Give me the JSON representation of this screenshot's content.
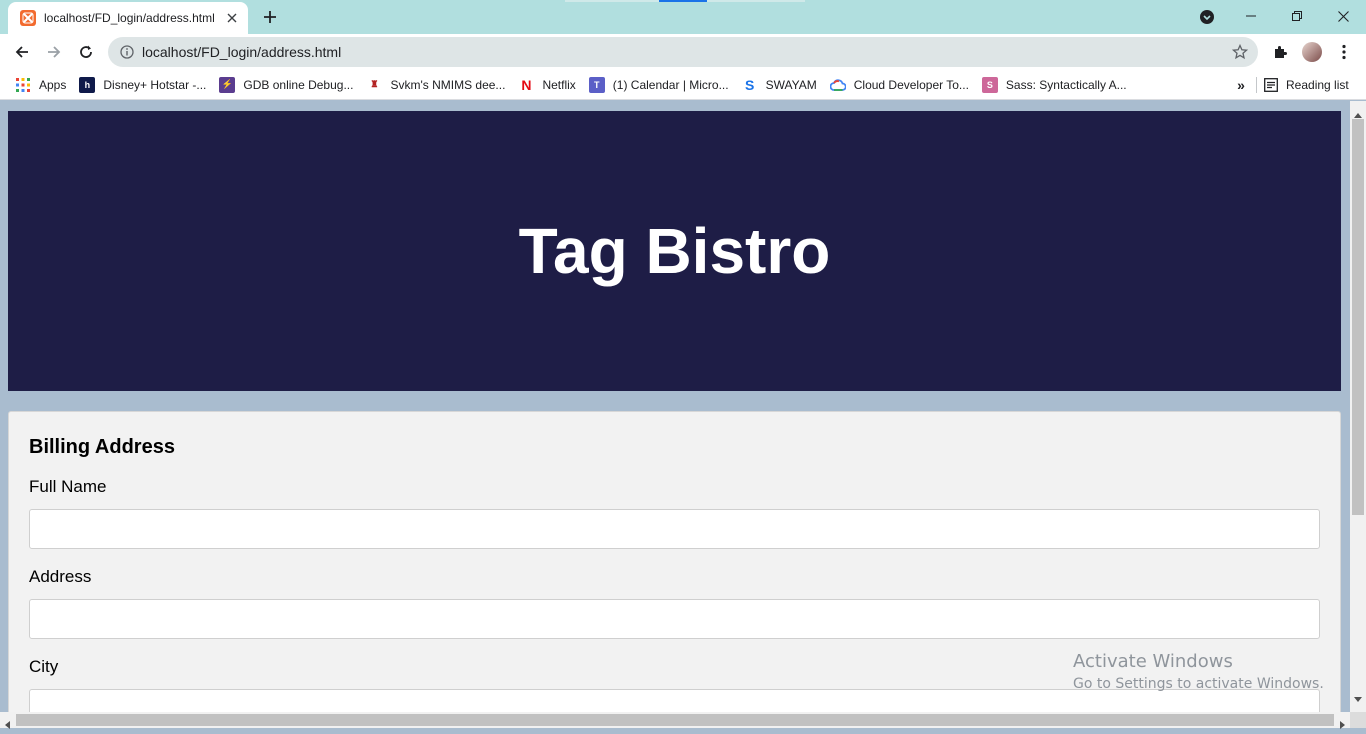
{
  "browser": {
    "tab": {
      "title": "localhost/FD_login/address.html",
      "favicon": "xampp-icon"
    },
    "url": "localhost/FD_login/address.html",
    "bookmarks": [
      {
        "label": "Apps",
        "icon": "apps-grid-icon"
      },
      {
        "label": "Disney+ Hotstar -...",
        "icon": "hotstar-icon"
      },
      {
        "label": "GDB online Debug...",
        "icon": "gdb-icon"
      },
      {
        "label": "Svkm's NMIMS dee...",
        "icon": "nmims-icon"
      },
      {
        "label": "Netflix",
        "icon": "netflix-icon"
      },
      {
        "label": "(1) Calendar | Micro...",
        "icon": "teams-icon"
      },
      {
        "label": "SWAYAM",
        "icon": "swayam-icon"
      },
      {
        "label": "Cloud Developer To...",
        "icon": "google-cloud-icon"
      },
      {
        "label": "Sass: Syntactically A...",
        "icon": "sass-icon"
      }
    ],
    "bookmarks_overflow": "»",
    "reading_list": "Reading list"
  },
  "page": {
    "hero_title": "Tag Bistro",
    "form": {
      "heading": "Billing Address",
      "fields": [
        {
          "label": "Full Name",
          "value": ""
        },
        {
          "label": "Address",
          "value": ""
        },
        {
          "label": "City",
          "value": ""
        }
      ]
    }
  },
  "watermark": {
    "line1": "Activate Windows",
    "line2": "Go to Settings to activate Windows."
  },
  "colors": {
    "hero_bg": "#1e1d46",
    "page_bg": "#a9bccf",
    "card_bg": "#f2f2f2",
    "tabstrip_bg": "#b1dfdf"
  }
}
